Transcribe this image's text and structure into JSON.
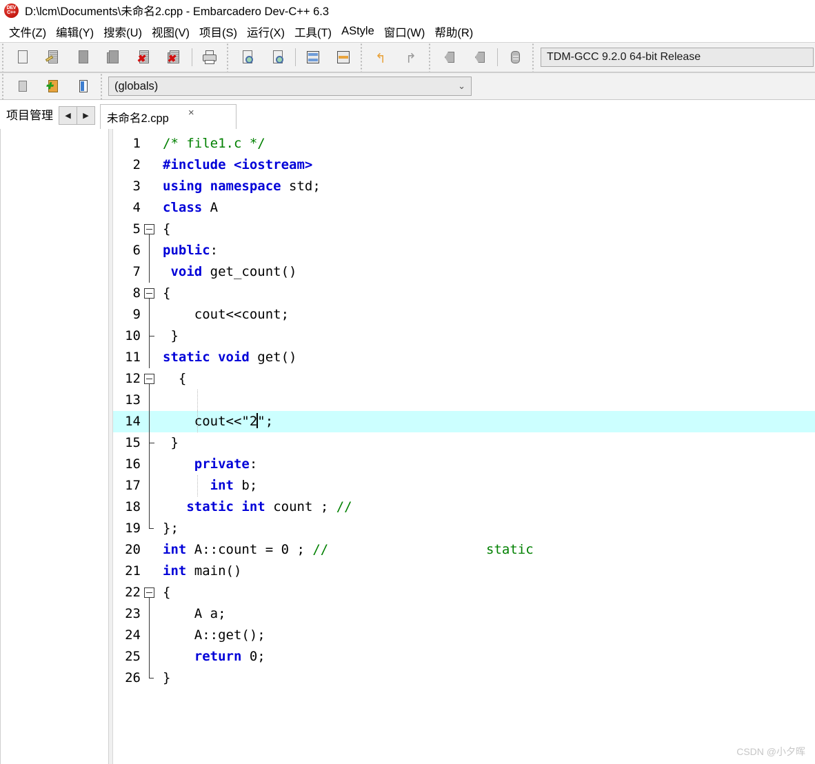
{
  "window": {
    "logo_text": "DEV C++",
    "title": "D:\\lcm\\Documents\\未命名2.cpp - Embarcadero Dev-C++ 6.3"
  },
  "menubar": {
    "items": [
      {
        "label": "文件(Z)",
        "name": "menu-file"
      },
      {
        "label": "编辑(Y)",
        "name": "menu-edit"
      },
      {
        "label": "搜索(U)",
        "name": "menu-search"
      },
      {
        "label": "视图(V)",
        "name": "menu-view"
      },
      {
        "label": "项目(S)",
        "name": "menu-project"
      },
      {
        "label": "运行(X)",
        "name": "menu-run"
      },
      {
        "label": "工具(T)",
        "name": "menu-tools"
      },
      {
        "label": "AStyle",
        "name": "menu-astyle"
      },
      {
        "label": "窗口(W)",
        "name": "menu-window"
      },
      {
        "label": "帮助(R)",
        "name": "menu-help"
      }
    ]
  },
  "toolbar_main": {
    "compiler_label": "TDM-GCC 9.2.0 64-bit Release",
    "buttons": [
      {
        "name": "new-file-button",
        "icon": "new-file-icon"
      },
      {
        "name": "open-file-button",
        "icon": "open-file-icon"
      },
      {
        "name": "save-file-button",
        "icon": "save-file-icon"
      },
      {
        "name": "save-all-button",
        "icon": "save-all-icon"
      },
      {
        "name": "close-file-button",
        "icon": "close-file-icon"
      },
      {
        "name": "close-all-button",
        "icon": "close-all-icon"
      },
      {
        "name": "print-button",
        "icon": "printer-icon"
      },
      {
        "name": "find-button",
        "icon": "search-icon"
      },
      {
        "name": "replace-button",
        "icon": "search-replace-icon"
      },
      {
        "name": "toggle-panel-button",
        "icon": "window-split-icon"
      },
      {
        "name": "goto-line-button",
        "icon": "goto-line-icon"
      },
      {
        "name": "undo-button",
        "icon": "undo-arrow-icon"
      },
      {
        "name": "redo-button",
        "icon": "redo-arrow-icon"
      },
      {
        "name": "prev-tab-button",
        "icon": "tab-left-icon"
      },
      {
        "name": "next-tab-button",
        "icon": "tab-right-icon"
      },
      {
        "name": "comment-button",
        "icon": "comment-block-icon"
      }
    ]
  },
  "toolbar_second": {
    "buttons": [
      {
        "name": "insert-snippet-button",
        "icon": "insert-snippet-icon"
      },
      {
        "name": "add-to-project-button",
        "icon": "add-green-plus-icon"
      },
      {
        "name": "toggle-bookmark-button",
        "icon": "bookmark-blue-icon"
      }
    ],
    "scope_combo": {
      "value": "(globals)",
      "chevron": "chevron-down-icon"
    }
  },
  "panels": {
    "project_tab_label": "项目管理",
    "nav_prev": "◀",
    "nav_next": "▶"
  },
  "editor_tabs": [
    {
      "label": "未命名2.cpp",
      "close": "×",
      "active": true
    }
  ],
  "editor": {
    "highlight_line": 14,
    "caret_line": 14,
    "lines": [
      {
        "n": 1,
        "fold": "none",
        "tokens": [
          {
            "t": "/* file1.c */",
            "c": "cm"
          }
        ]
      },
      {
        "n": 2,
        "fold": "none",
        "tokens": [
          {
            "t": "#include",
            "c": "pp"
          },
          {
            "t": " ",
            "c": "pl"
          },
          {
            "t": "<iostream>",
            "c": "pp"
          }
        ]
      },
      {
        "n": 3,
        "fold": "none",
        "tokens": [
          {
            "t": "using",
            "c": "kw"
          },
          {
            "t": " ",
            "c": "pl"
          },
          {
            "t": "namespace",
            "c": "kw"
          },
          {
            "t": " std;",
            "c": "pl"
          }
        ]
      },
      {
        "n": 4,
        "fold": "none",
        "tokens": [
          {
            "t": "class",
            "c": "kw"
          },
          {
            "t": " A",
            "c": "pl"
          }
        ]
      },
      {
        "n": 5,
        "fold": "open",
        "tokens": [
          {
            "t": "{",
            "c": "pl"
          }
        ]
      },
      {
        "n": 6,
        "fold": "bar",
        "tokens": [
          {
            "t": "public",
            "c": "kw"
          },
          {
            "t": ":",
            "c": "pl"
          }
        ]
      },
      {
        "n": 7,
        "fold": "bar",
        "tokens": [
          {
            "t": " ",
            "c": "pl"
          },
          {
            "t": "void",
            "c": "kw"
          },
          {
            "t": " get_count()",
            "c": "pl"
          }
        ]
      },
      {
        "n": 8,
        "fold": "open",
        "tokens": [
          {
            "t": "{",
            "c": "pl"
          }
        ]
      },
      {
        "n": 9,
        "fold": "bar",
        "tokens": [
          {
            "t": "    cout<<count;",
            "c": "pl"
          }
        ]
      },
      {
        "n": 10,
        "fold": "close",
        "tokens": [
          {
            "t": " }",
            "c": "pl"
          }
        ]
      },
      {
        "n": 11,
        "fold": "bar",
        "tokens": [
          {
            "t": "static",
            "c": "kw"
          },
          {
            "t": " ",
            "c": "pl"
          },
          {
            "t": "void",
            "c": "kw"
          },
          {
            "t": " get()",
            "c": "pl"
          }
        ]
      },
      {
        "n": 12,
        "fold": "open",
        "tokens": [
          {
            "t": "  {",
            "c": "pl"
          }
        ]
      },
      {
        "n": 13,
        "fold": "bar",
        "tokens": [
          {
            "t": "",
            "c": "pl"
          }
        ]
      },
      {
        "n": 14,
        "fold": "bar",
        "tokens": [
          {
            "t": "    cout<<\"2",
            "c": "pl"
          },
          {
            "t": "CARET",
            "c": "caret"
          },
          {
            "t": "\";",
            "c": "pl"
          }
        ]
      },
      {
        "n": 15,
        "fold": "close",
        "tokens": [
          {
            "t": " }",
            "c": "pl"
          }
        ]
      },
      {
        "n": 16,
        "fold": "bar",
        "tokens": [
          {
            "t": "    ",
            "c": "pl"
          },
          {
            "t": "private",
            "c": "kw"
          },
          {
            "t": ":",
            "c": "pl"
          }
        ]
      },
      {
        "n": 17,
        "fold": "bar",
        "tokens": [
          {
            "t": "      ",
            "c": "pl"
          },
          {
            "t": "int",
            "c": "kw"
          },
          {
            "t": " b;",
            "c": "pl"
          }
        ]
      },
      {
        "n": 18,
        "fold": "bar",
        "tokens": [
          {
            "t": "   ",
            "c": "pl"
          },
          {
            "t": "static",
            "c": "kw"
          },
          {
            "t": " ",
            "c": "pl"
          },
          {
            "t": "int",
            "c": "kw"
          },
          {
            "t": " count ; ",
            "c": "pl"
          },
          {
            "t": "//",
            "c": "cm"
          }
        ]
      },
      {
        "n": 19,
        "fold": "endall",
        "tokens": [
          {
            "t": "};",
            "c": "pl"
          }
        ]
      },
      {
        "n": 20,
        "fold": "none",
        "tokens": [
          {
            "t": "int",
            "c": "kw"
          },
          {
            "t": " A::count = 0 ; ",
            "c": "pl"
          },
          {
            "t": "//                    static",
            "c": "cm"
          }
        ]
      },
      {
        "n": 21,
        "fold": "none",
        "tokens": [
          {
            "t": "int",
            "c": "kw"
          },
          {
            "t": " main()",
            "c": "pl"
          }
        ]
      },
      {
        "n": 22,
        "fold": "open",
        "tokens": [
          {
            "t": "{",
            "c": "pl"
          }
        ]
      },
      {
        "n": 23,
        "fold": "bar",
        "tokens": [
          {
            "t": "    A a;",
            "c": "pl"
          }
        ]
      },
      {
        "n": 24,
        "fold": "bar",
        "tokens": [
          {
            "t": "    A::get();",
            "c": "pl"
          }
        ]
      },
      {
        "n": 25,
        "fold": "bar",
        "tokens": [
          {
            "t": "    ",
            "c": "pl"
          },
          {
            "t": "return",
            "c": "kw"
          },
          {
            "t": " 0;",
            "c": "pl"
          }
        ]
      },
      {
        "n": 26,
        "fold": "endall",
        "tokens": [
          {
            "t": "}",
            "c": "pl"
          }
        ]
      }
    ]
  },
  "watermark": {
    "text": "CSDN @小夕晖"
  },
  "colors": {
    "keyword": "#0000d8",
    "comment": "#008000",
    "plain": "#000000",
    "highlight_line_bg": "#ccffff",
    "toolbar_bg": "#f2f2f2"
  }
}
